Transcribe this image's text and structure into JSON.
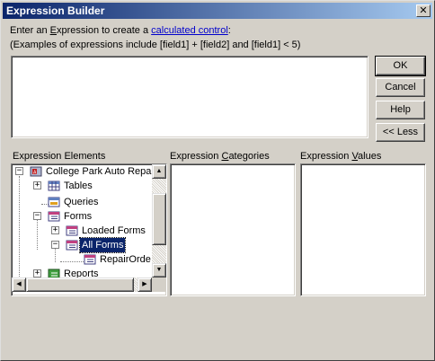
{
  "window": {
    "title": "Expression Builder",
    "close_glyph": "✕"
  },
  "instructions": {
    "prefix": "Enter an ",
    "hotkey_letter": "E",
    "mid": "xpression to create a ",
    "link": "calculated control",
    "suffix": ":",
    "examples": "(Examples of expressions include [field1] + [field2] and [field1] < 5)"
  },
  "expression_input": {
    "value": ""
  },
  "buttons": {
    "ok": "OK",
    "cancel": "Cancel",
    "help": "Help",
    "less": "<< Less"
  },
  "panels": {
    "elements_label": "Expression Elements",
    "categories_pre": "Expression ",
    "categories_hot": "C",
    "categories_post": "ategories",
    "values_pre": "Expression ",
    "values_hot": "V",
    "values_post": "alues"
  },
  "tree": {
    "items": [
      {
        "label": "College Park Auto Repa",
        "icon": "database-icon",
        "expander": "−"
      },
      {
        "label": "Tables",
        "icon": "table-icon",
        "expander": "+"
      },
      {
        "label": "Queries",
        "icon": "query-icon",
        "expander": ""
      },
      {
        "label": "Forms",
        "icon": "form-icon",
        "expander": "−"
      },
      {
        "label": "Loaded Forms",
        "icon": "form-icon",
        "expander": "+"
      },
      {
        "label": "All Forms",
        "icon": "form-icon",
        "expander": "−",
        "selected": true
      },
      {
        "label": "RepairOrde",
        "icon": "form-icon",
        "expander": ""
      },
      {
        "label": "Reports",
        "icon": "report-icon",
        "expander": "+"
      }
    ]
  },
  "scroll_glyphs": {
    "up": "▲",
    "down": "▼",
    "left": "◀",
    "right": "▶"
  },
  "colors": {
    "title_start": "#0a246a",
    "title_end": "#a6caf0",
    "selection": "#0a246a",
    "link": "#0000cc",
    "face": "#d4d0c8"
  }
}
